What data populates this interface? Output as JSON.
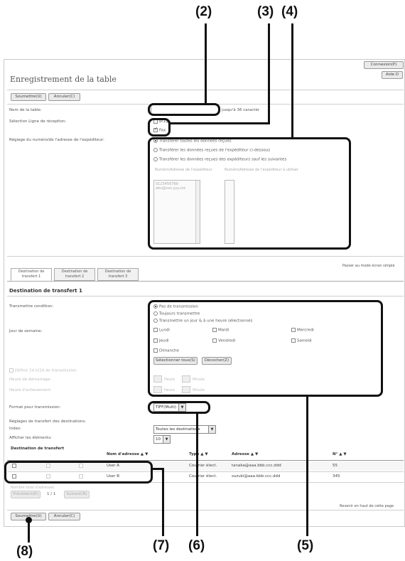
{
  "callouts": {
    "c2": "(2)",
    "c3": "(3)",
    "c4": "(4)",
    "c5": "(5)",
    "c6": "(6)",
    "c7": "(7)",
    "c8": "(8)"
  },
  "header": {
    "title": "Enregistrement de la table",
    "connexion": "Connexion(P)",
    "aide": "Aide D"
  },
  "toolbar": {
    "soumettre": "Soumettre(U)",
    "annuler": "Annuler(C)"
  },
  "form": {
    "table_name_label": "Nom de la table:",
    "table_name_hint": "jusqu'à 36 caractèr",
    "reception_label": "Sélection Ligne de réception:",
    "ipfax_label": "IP-Fax",
    "fax_label": "Fax",
    "sender_label": "Réglage du numéro/de l'adresse de l'expéditeur:",
    "radio_all": "Transférer toutes les données reçues",
    "radio_from": "Transférer les données reçues de l'expéditeur ci-dessous",
    "radio_except": "Transférer les données reçues des expéditeurs sauf les suivantes",
    "list_left_title": "Numéro/Adresse de l'expéditeur",
    "list_right_title": "Numéro/Adresse de l'expéditeur à utiliser",
    "list_left_items": [
      "0123456789",
      "abc@xxx.yyy.zzz"
    ],
    "simple_mode": "Passer au mode écran simple"
  },
  "tabs": [
    {
      "line1": "Destination de",
      "line2": "transfert 1"
    },
    {
      "line1": "Destination de",
      "line2": "transfert 2"
    },
    {
      "line1": "Destination de",
      "line2": "transfert 3"
    }
  ],
  "section": {
    "title": "Destination de transfert 1",
    "transmit_label": "Transmettre condition:",
    "no_transmit": "Pas de transmission",
    "always_transmit": "Toujours transmettre",
    "day_time_transmit": "Transmettre un jour & à une heure sélectionnés",
    "weekday_label": "Jour de semaine:",
    "days": [
      "Lundi",
      "Mardi",
      "Mercredi",
      "Jeudi",
      "Vendredi",
      "Samedi",
      "Dimanche"
    ],
    "select_all": "Sélectionner tous(S)",
    "deselect": "Décocher(Z)",
    "all_day": "Définir 24 h/24 de transmission",
    "start_time": "Heure de démarrage:",
    "end_time": "Heure d'achèvement:",
    "hour_unit": "Heure",
    "min_unit": "Minute",
    "format_label": "Format pour transmission:",
    "format_value": "TIFF(Multi)"
  },
  "destinations": {
    "settings_label": "Réglages de transfert des destinations:",
    "index_label": "Index:",
    "index_value": "Toutes les destinations",
    "show_label": "Afficher les éléments:",
    "show_value": "10",
    "table_title": "Destination de transfert",
    "col_name": "Nom d'adresse ▲ ▼",
    "col_type": "Type ▲ ▼",
    "col_address": "Adresse ▲ ▼",
    "col_no": "N° ▲ ▼",
    "rows": [
      {
        "name": "User A",
        "type": "Courrier élect.",
        "address": "tanaka@aaa.bbb.ccc.ddd",
        "no": "55"
      },
      {
        "name": "User B",
        "type": "Courrier élect.",
        "address": "suzuki@aaa.bbb.ccc.ddd",
        "no": "345"
      }
    ],
    "total_label": "Nombre total d'adresses",
    "prev": "Précédent(R)",
    "page": "1 / 1",
    "next": "Suivant(N)",
    "back_top": "Revenir en haut de cette page"
  }
}
